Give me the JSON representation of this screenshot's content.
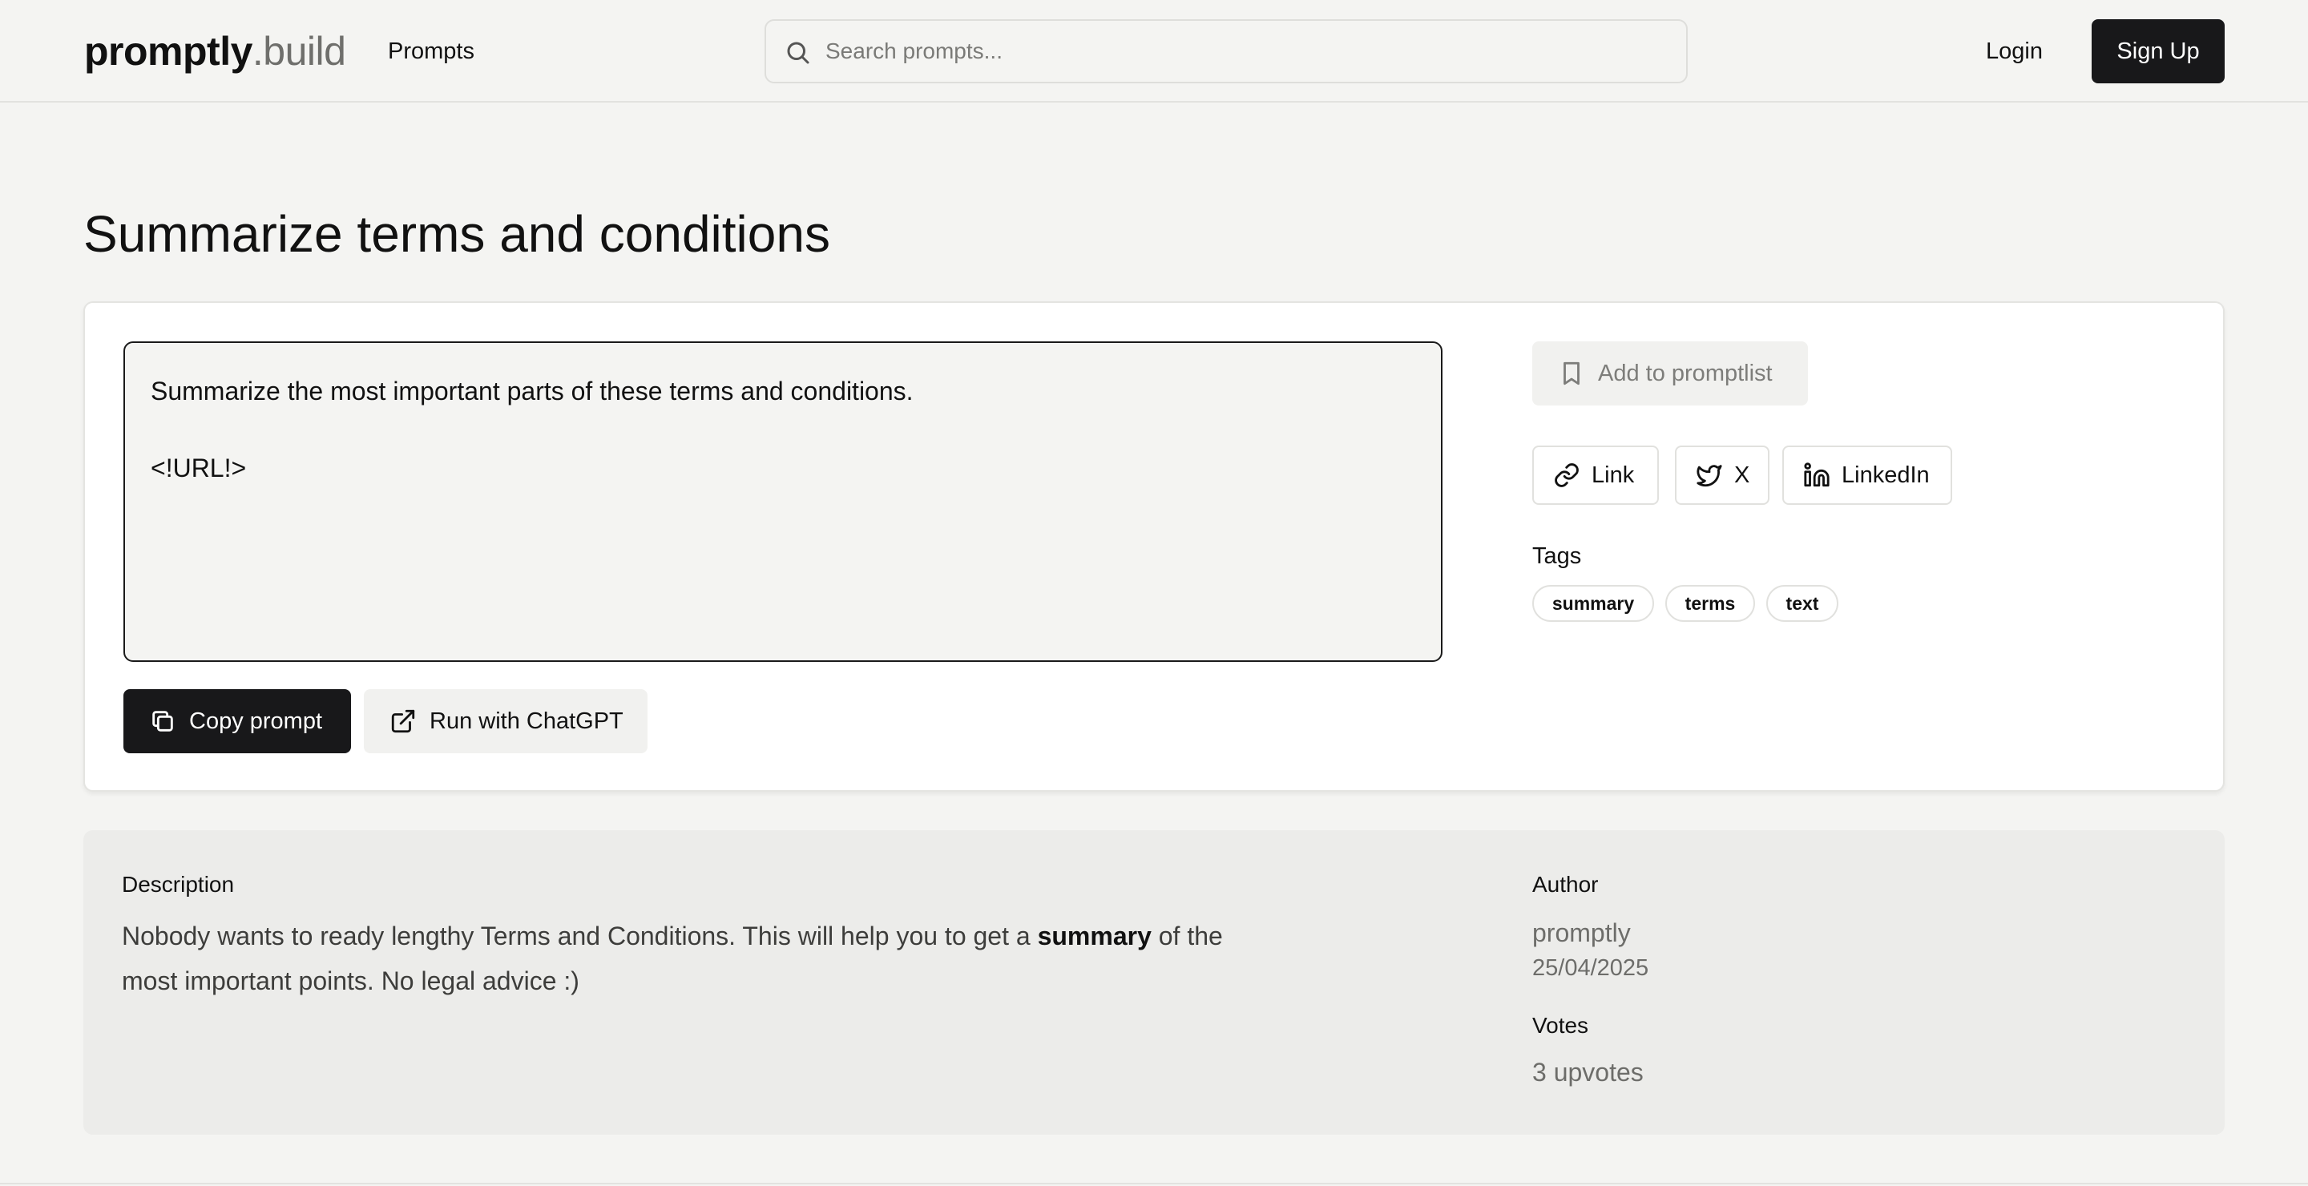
{
  "header": {
    "logo_bold": "promptly",
    "logo_light": ".build",
    "nav_prompts": "Prompts",
    "search_placeholder": "Search prompts...",
    "login": "Login",
    "signup": "Sign Up"
  },
  "page": {
    "title": "Summarize terms and conditions"
  },
  "prompt": {
    "text": "Summarize the most important parts of these terms and conditions.\n\n<!URL!>",
    "copy_label": "Copy prompt",
    "run_label": "Run with ChatGPT"
  },
  "sidebar": {
    "add_to_promptlist": "Add to promptlist",
    "share": [
      {
        "label": "Link",
        "icon": "link-icon"
      },
      {
        "label": "X",
        "icon": "twitter-icon"
      },
      {
        "label": "LinkedIn",
        "icon": "linkedin-icon"
      }
    ],
    "tags_heading": "Tags",
    "tags": [
      "summary",
      "terms",
      "text"
    ]
  },
  "details": {
    "description_heading": "Description",
    "description_before": "Nobody wants to ready lengthy Terms and Conditions. This will help you to get a ",
    "description_bold": "summary",
    "description_after": " of the most important points. No legal advice :)",
    "author_heading": "Author",
    "author_name": "promptly",
    "author_date": "25/04/2025",
    "votes_heading": "Votes",
    "votes_value": "3 upvotes"
  },
  "colors": {
    "background": "#f4f4f2",
    "primary_button": "#18181a",
    "card": "#ffffff",
    "details_panel": "#ececea"
  }
}
